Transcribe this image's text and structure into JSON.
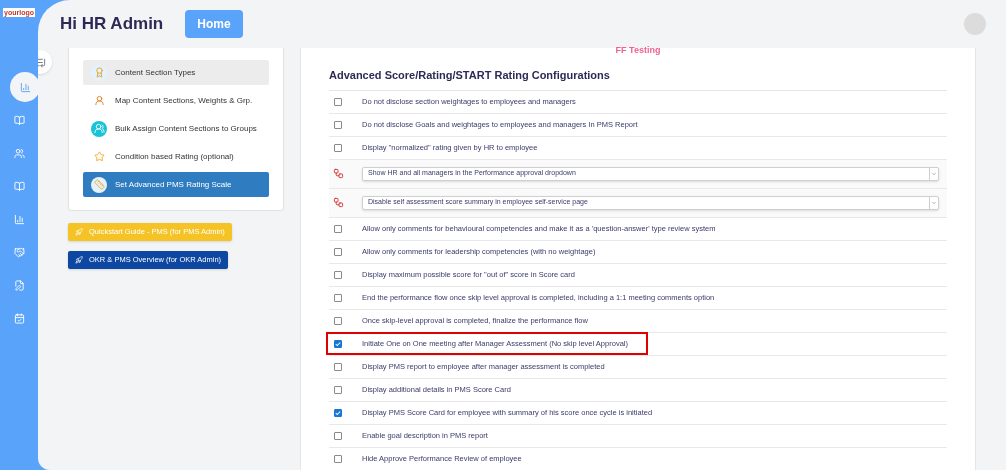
{
  "logo": "yourlogo",
  "header": {
    "greeting": "Hi HR Admin",
    "home_button": "Home"
  },
  "sidebar": {
    "items": [
      {
        "selected": true
      },
      {
        "selected": false
      },
      {
        "selected": false
      },
      {
        "selected": false
      },
      {
        "selected": false
      },
      {
        "selected": false
      },
      {
        "selected": false
      },
      {
        "selected": false
      }
    ]
  },
  "menu": {
    "items": [
      {
        "label": "Content Section Types",
        "selected": false,
        "hovered": true
      },
      {
        "label": "Map Content Sections, Weights & Grp.",
        "selected": false
      },
      {
        "label": "Bulk Assign Content Sections to Groups",
        "selected": false
      },
      {
        "label": "Condition based Rating (optional)",
        "selected": false
      },
      {
        "label": "Set Advanced PMS Rating Scale",
        "selected": true
      }
    ]
  },
  "guide_buttons": [
    {
      "label": "Quickstart Guide - PMS (for PMS Admin)",
      "color": "#f5c325"
    },
    {
      "label": "OKR & PMS Overview (for OKR Admin)",
      "color": "#0d47a1"
    }
  ],
  "content": {
    "subtitle": "FF Testing",
    "title": "Advanced Score/Rating/START Rating Configurations",
    "rows": [
      {
        "kind": "checkbox",
        "label": "Do not disclose section weightages to employees and managers",
        "checked": false,
        "highlighted": false
      },
      {
        "kind": "checkbox",
        "label": "Do not disclose Goals and weightages to employees and managers In PMS Report",
        "checked": false,
        "highlighted": false
      },
      {
        "kind": "checkbox",
        "label": "Display \"normalized\" rating given by HR to employee",
        "checked": false,
        "highlighted": false
      },
      {
        "kind": "select",
        "label": "Show HR and all managers in the Performance approval dropdown"
      },
      {
        "kind": "select",
        "label": "Disable self assessment score summary in employee self-service page"
      },
      {
        "kind": "checkbox",
        "label": "Allow only comments for behavioural competencies and make it as a 'question-answer' type review system",
        "checked": false,
        "highlighted": false
      },
      {
        "kind": "checkbox",
        "label": "Allow only comments for leadership competencies (with no weightage)",
        "checked": false,
        "highlighted": false
      },
      {
        "kind": "checkbox",
        "label": "Display maximum possible score for \"out of\" score in Score card",
        "checked": false,
        "highlighted": false
      },
      {
        "kind": "checkbox",
        "label": "End the performance flow once skip level approval is completed, including a 1:1 meeting comments option",
        "checked": false,
        "highlighted": false
      },
      {
        "kind": "checkbox",
        "label": "Once skip-level approval is completed, finalize the performance flow",
        "checked": false,
        "highlighted": false
      },
      {
        "kind": "checkbox",
        "label": "Initiate One on One meeting after Manager Assessment (No skip level Approval)",
        "checked": true,
        "highlighted": true
      },
      {
        "kind": "checkbox",
        "label": "Display PMS report to employee after manager assessment is completed",
        "checked": false,
        "highlighted": false
      },
      {
        "kind": "checkbox",
        "label": "Display additional details in PMS Score Card",
        "checked": false,
        "highlighted": false
      },
      {
        "kind": "checkbox",
        "label": "Display PMS Score Card for employee with summary of his score once cycle is initiated",
        "checked": true,
        "highlighted": false
      },
      {
        "kind": "checkbox",
        "label": "Enable goal description in PMS report",
        "checked": false,
        "highlighted": false
      },
      {
        "kind": "checkbox",
        "label": "Hide Approve Performance Review of employee",
        "checked": false,
        "highlighted": false
      }
    ]
  }
}
